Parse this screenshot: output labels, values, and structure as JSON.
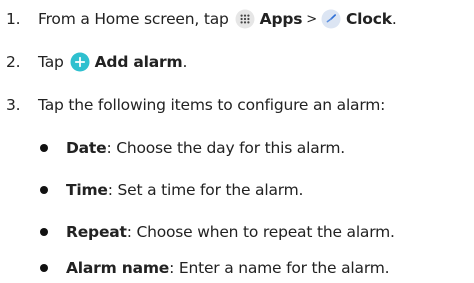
{
  "steps": [
    {
      "number": "1.",
      "pre": "From a Home screen, tap",
      "apps_label": "Apps",
      "separator": ">",
      "clock_label": "Clock",
      "end": "."
    },
    {
      "number": "2.",
      "pre": "Tap",
      "add_alarm_label": "Add alarm",
      "end": "."
    },
    {
      "number": "3.",
      "text": "Tap the following items to configure an alarm:"
    }
  ],
  "options": [
    {
      "term": "Date",
      "desc": ": Choose the day for this alarm."
    },
    {
      "term": "Time",
      "desc": ": Set a time for the alarm."
    },
    {
      "term": "Repeat",
      "desc": ": Choose when to repeat the alarm."
    },
    {
      "term": "Alarm name",
      "desc": ": Enter a name for the alarm."
    }
  ],
  "icons": {
    "apps": "apps-grid-icon",
    "clock": "clock-icon",
    "add": "add-plus-icon"
  },
  "colors": {
    "text": "#222222",
    "add_icon": "#2fc0cf",
    "clock_icon_bg": "#dce5f3",
    "clock_hands": "#2f6fd6",
    "apps_icon_bg": "#e6e6e6"
  }
}
